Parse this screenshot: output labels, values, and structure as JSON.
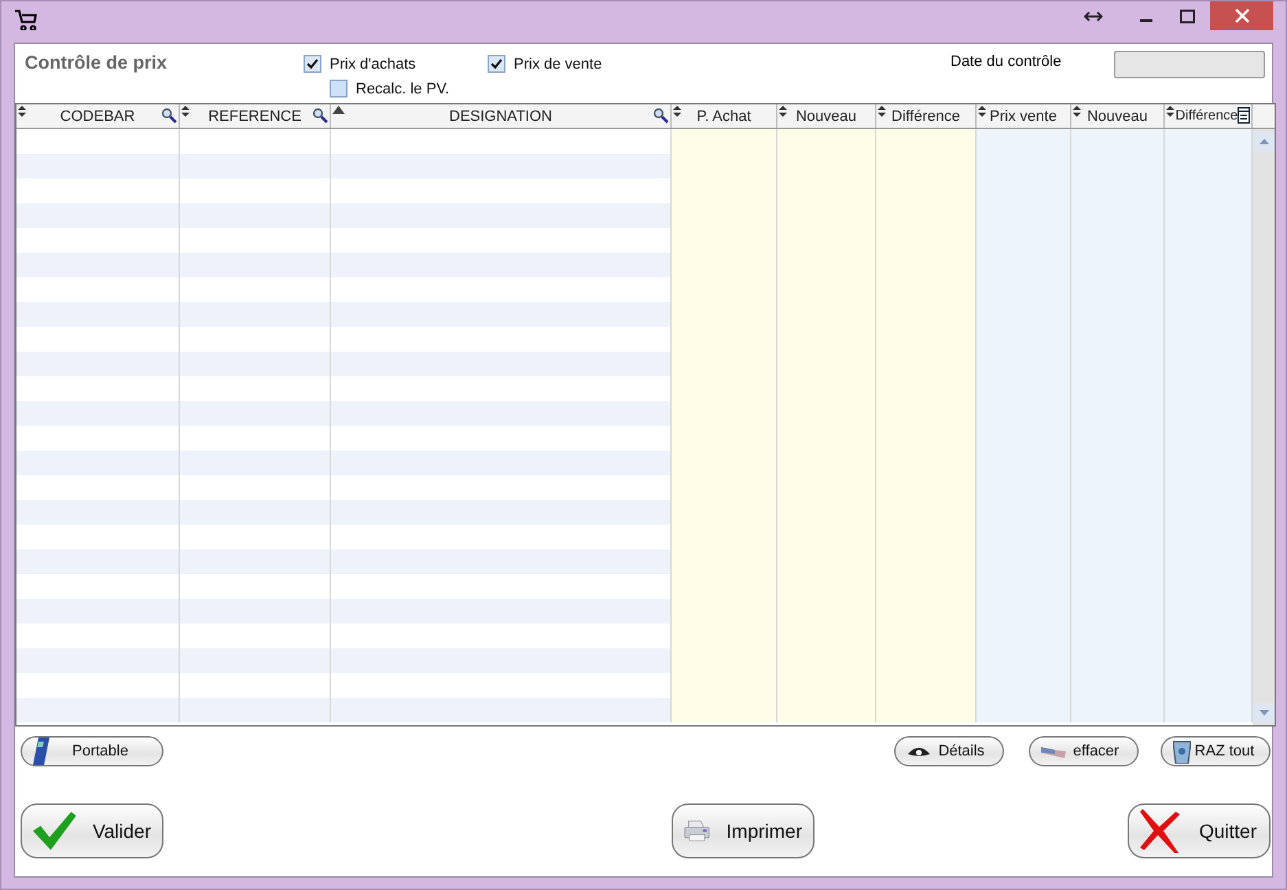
{
  "window": {
    "controls": [
      {
        "kind": "resize"
      },
      {
        "kind": "minimize"
      },
      {
        "kind": "maximize"
      },
      {
        "kind": "close"
      }
    ]
  },
  "header": {
    "title": "Contrôle de prix",
    "date_label": "Date du contrôle"
  },
  "options": [
    {
      "label": "Prix d'achats",
      "checked": true
    },
    {
      "label": "Prix de vente",
      "checked": true
    },
    {
      "label": "Recalc. le PV.",
      "checked": false
    }
  ],
  "table": {
    "columns": [
      {
        "label": "CODEBAR"
      },
      {
        "label": "REFERENCE"
      },
      {
        "label": "DESIGNATION"
      },
      {
        "label": "P. Achat"
      },
      {
        "label": "Nouveau"
      },
      {
        "label": "Différence"
      },
      {
        "label": "Prix vente"
      },
      {
        "label": "Nouveau"
      },
      {
        "label": "Différence"
      }
    ]
  },
  "small_buttons": [
    {
      "label": "Portable",
      "kind": "device"
    },
    {
      "label": "Détails",
      "kind": "eye"
    },
    {
      "label": "effacer",
      "kind": "eraser"
    },
    {
      "label": "RAZ tout",
      "kind": "bin"
    }
  ],
  "big_buttons": [
    {
      "label": "Valider",
      "kind": "check"
    },
    {
      "label": "Imprimer",
      "kind": "printer"
    },
    {
      "label": "Quitter",
      "kind": "cross"
    }
  ]
}
